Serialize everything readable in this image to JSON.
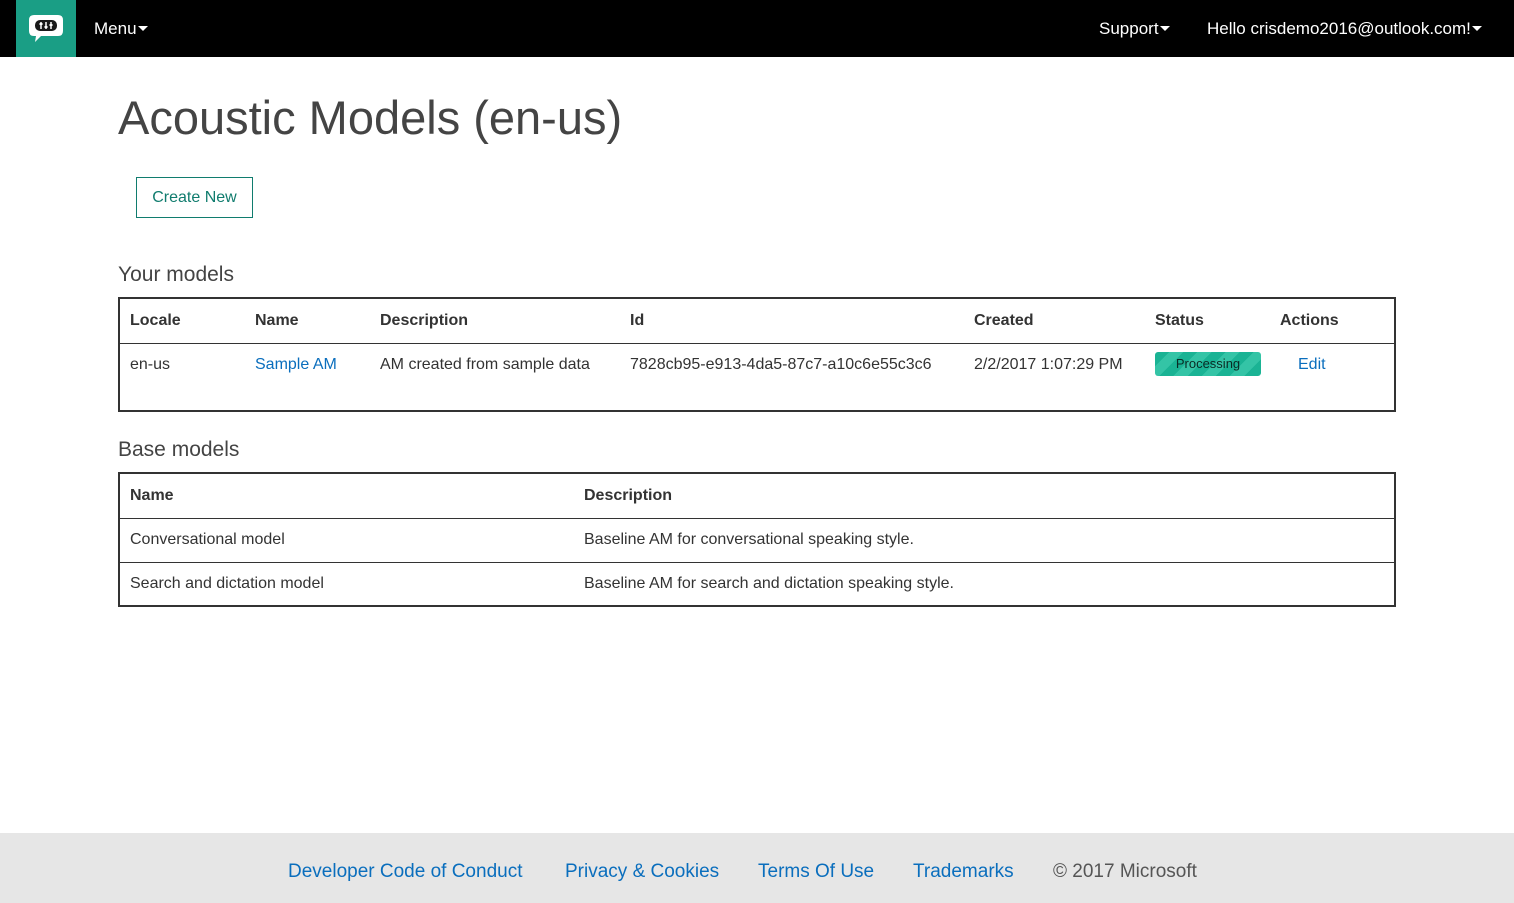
{
  "nav": {
    "menu_label": "Menu",
    "support_label": "Support",
    "user_greeting": "Hello crisdemo2016@outlook.com!"
  },
  "page": {
    "title": "Acoustic Models (en-us)",
    "create_button": "Create New"
  },
  "your_models": {
    "title": "Your models",
    "headers": [
      "Locale",
      "Name",
      "Description",
      "Id",
      "Created",
      "Status",
      "Actions"
    ],
    "rows": [
      {
        "locale": "en-us",
        "name": "Sample AM",
        "description": "AM created from sample data",
        "id": "7828cb95-e913-4da5-87c7-a10c6e55c3c6",
        "created": "2/2/2017 1:07:29 PM",
        "status": "Processing",
        "action": "Edit"
      }
    ]
  },
  "base_models": {
    "title": "Base models",
    "headers": [
      "Name",
      "Description"
    ],
    "rows": [
      {
        "name": "Conversational model",
        "description": "Baseline AM for conversational speaking style."
      },
      {
        "name": "Search and dictation model",
        "description": "Baseline AM for search and dictation speaking style."
      }
    ]
  },
  "footer": {
    "links": [
      "Developer Code of Conduct",
      "Privacy & Cookies",
      "Terms Of Use",
      "Trademarks"
    ],
    "copyright": "© 2017 Microsoft"
  },
  "colors": {
    "nav_bg": "#000000",
    "brand": "#1a9e85",
    "link": "#0a6ebd",
    "status_processing": "#1ab394",
    "footer_bg": "#e6e6e6"
  },
  "icons": {
    "logo": "speech-bubble-mixer-icon",
    "menu_caret": "caret-down-icon"
  }
}
